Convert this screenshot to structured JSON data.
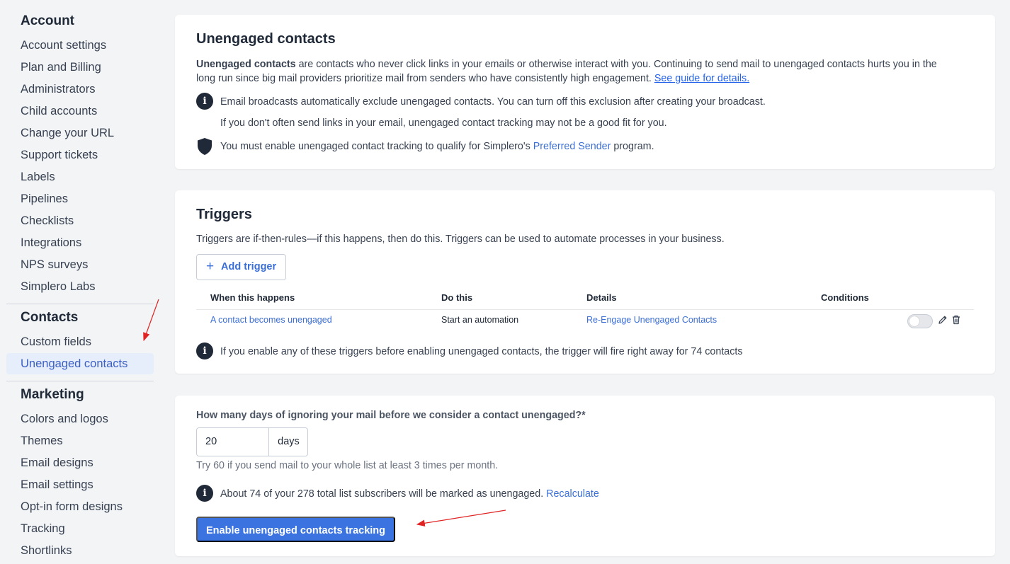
{
  "sidebar": {
    "account": {
      "heading": "Account",
      "items": [
        "Account settings",
        "Plan and Billing",
        "Administrators",
        "Child accounts",
        "Change your URL",
        "Support tickets",
        "Labels",
        "Pipelines",
        "Checklists",
        "Integrations",
        "NPS surveys",
        "Simplero Labs"
      ]
    },
    "contacts": {
      "heading": "Contacts",
      "items": [
        "Custom fields",
        "Unengaged contacts"
      ],
      "active": "Unengaged contacts"
    },
    "marketing": {
      "heading": "Marketing",
      "items": [
        "Colors and logos",
        "Themes",
        "Email designs",
        "Email settings",
        "Opt-in form designs",
        "Tracking",
        "Shortlinks"
      ]
    }
  },
  "unengaged": {
    "title": "Unengaged contacts",
    "intro_bold": "Unengaged contacts",
    "intro_rest": " are contacts who never click links in your emails or otherwise interact with you. Continuing to send mail to unengaged contacts hurts you in the",
    "intro_line2": "long run since big mail providers prioritize mail from senders who have consistently high engagement. ",
    "guide_link": "See guide for details.",
    "info1": "Email broadcasts automatically exclude unengaged contacts. You can turn off this exclusion after creating your broadcast.",
    "info2": "If you don't often send links in your email, unengaged contact tracking may not be a good fit for you.",
    "shield_pre": "You must enable unengaged contact tracking to qualify for Simplero's ",
    "shield_link": "Preferred Sender",
    "shield_post": " program."
  },
  "triggers": {
    "title": "Triggers",
    "description": "Triggers are if-then-rules—if this happens, then do this. Triggers can be used to automate processes in your business.",
    "add_button": "Add trigger",
    "add_button_icon": "plus-icon",
    "columns": [
      "When this happens",
      "Do this",
      "Details",
      "Conditions"
    ],
    "rows": [
      {
        "when": "A contact becomes unengaged",
        "do": "Start an automation",
        "details": "Re-Engage Unengaged Contacts",
        "conditions": "",
        "enabled": false
      }
    ],
    "warning": "If you enable any of these triggers before enabling unengaged contacts, the trigger will fire right away for 74 contacts"
  },
  "settings": {
    "question": "How many days of ignoring your mail before we consider a contact unengaged?*",
    "days_value": "20",
    "days_unit": "days",
    "hint": "Try 60 if you send mail to your whole list at least 3 times per month.",
    "estimate": "About 74 of your 278 total list subscribers will be marked as unengaged. ",
    "recalculate": "Recalculate",
    "enable_button": "Enable unengaged contacts tracking"
  },
  "colors": {
    "accent": "#3b73e0",
    "link": "#3b6fd6",
    "active_bg": "#e6eefb",
    "annotation_arrow": "#e02424"
  }
}
